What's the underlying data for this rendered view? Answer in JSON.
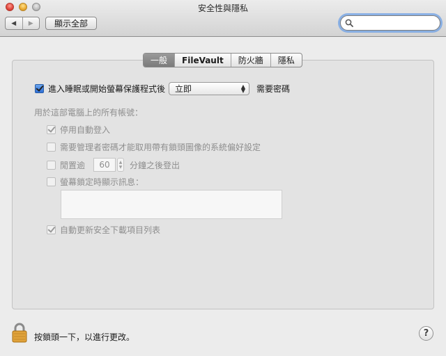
{
  "window": {
    "title": "安全性與隱私"
  },
  "toolbar": {
    "back_icon": "triangle-left",
    "forward_icon": "triangle-right",
    "show_all_label": "顯示全部",
    "search_value": "",
    "search_placeholder": ""
  },
  "tabs": [
    {
      "label": "一般",
      "selected": true
    },
    {
      "label": "FileVault",
      "selected": false
    },
    {
      "label": "防火牆",
      "selected": false
    },
    {
      "label": "隱私",
      "selected": false
    }
  ],
  "general": {
    "require_password": {
      "checked": true,
      "label_before": "進入睡眠或開始螢幕保護程式後",
      "popup_value": "立即",
      "label_after": "需要密碼"
    },
    "all_accounts_heading": "用於這部電腦上的所有帳號：",
    "options": {
      "disable_auto_login": {
        "checked": true,
        "label": "停用自動登入"
      },
      "require_admin_password": {
        "checked": false,
        "label": "需要管理者密碼才能取用帶有鎖頭圖像的系統偏好設定"
      },
      "logout_after": {
        "checked": false,
        "label_before": "閒置逾",
        "minutes": "60",
        "label_after": "分鐘之後登出"
      },
      "show_message": {
        "checked": false,
        "label": "螢幕鎖定時顯示訊息：",
        "message": ""
      },
      "auto_update_list": {
        "checked": true,
        "label": "自動更新安全下載項目列表"
      }
    }
  },
  "footer": {
    "lock_text": "按鎖頭一下，以進行更改。",
    "help_label": "?"
  },
  "colors": {
    "focus_ring": "#6ea0e6",
    "lock_gold": "#e0a23a",
    "selected_tab": "#8a8a8a"
  }
}
